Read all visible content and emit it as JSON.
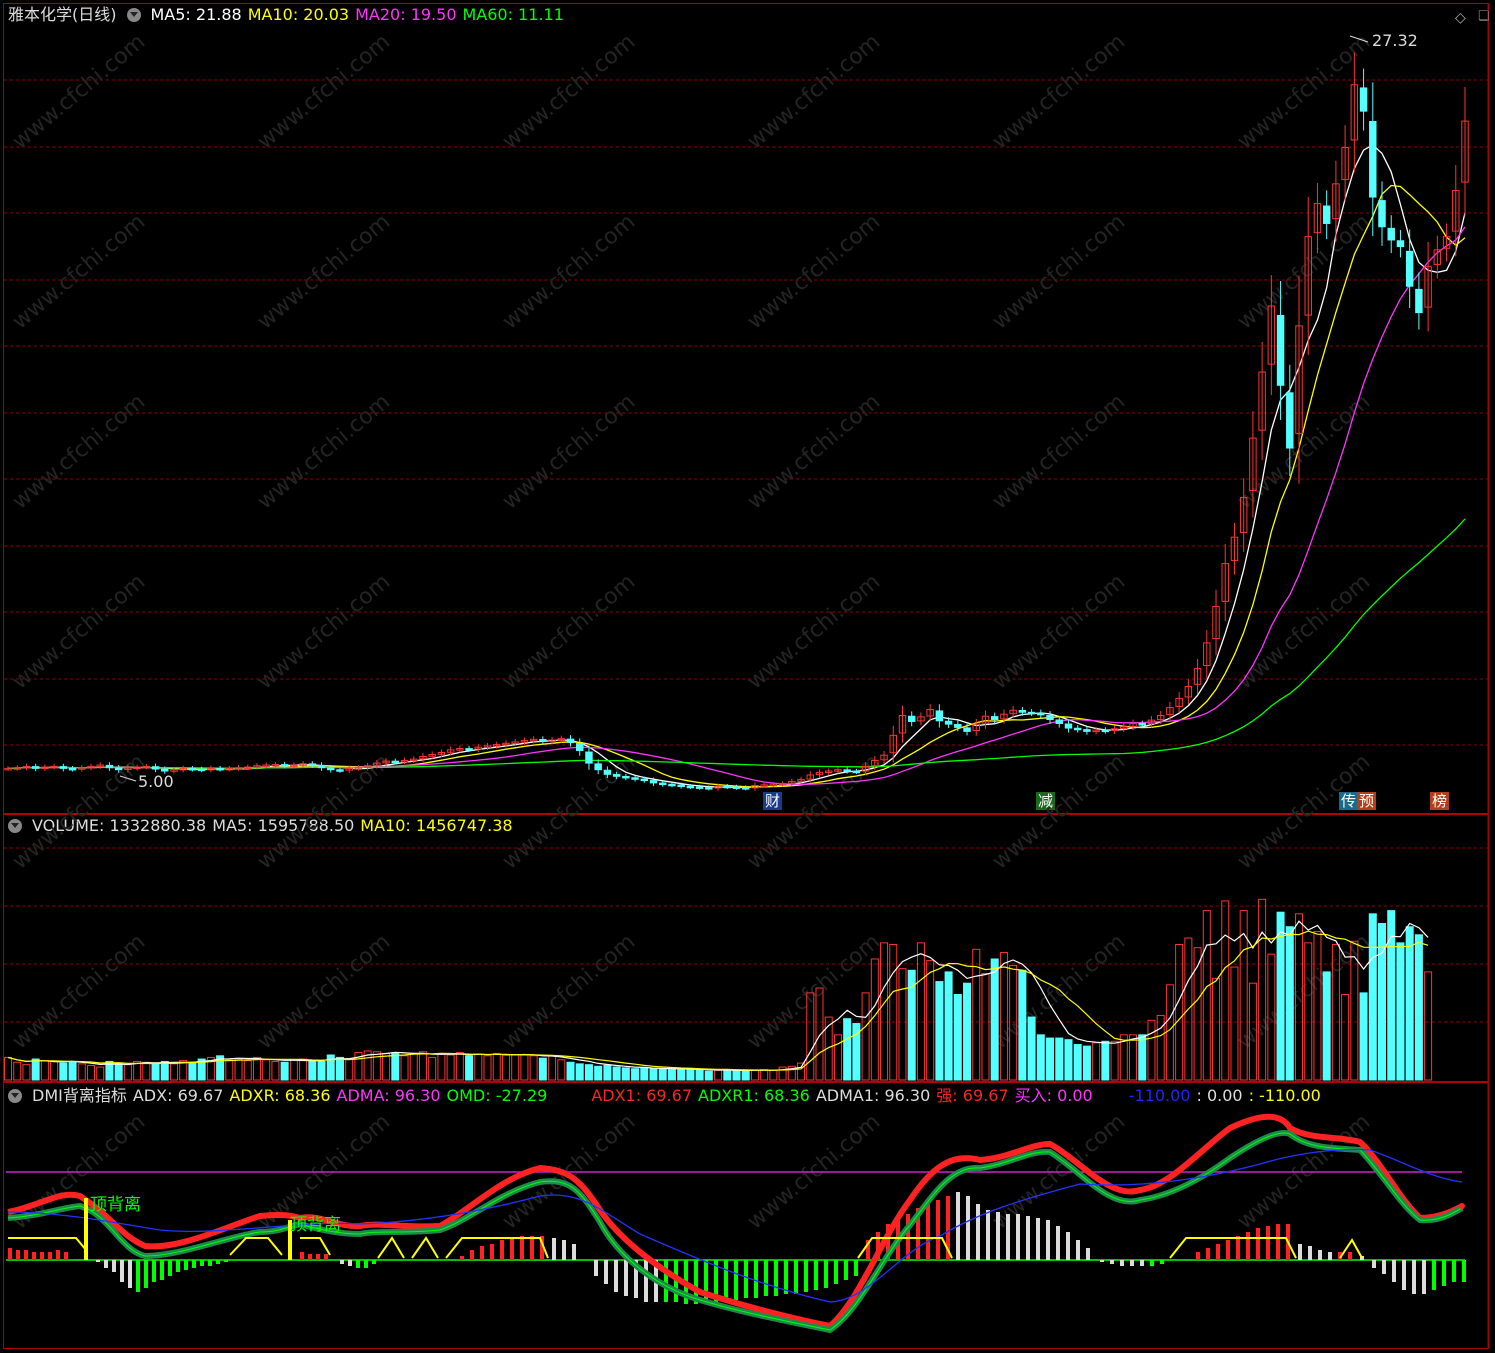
{
  "price_legend": {
    "title": "雅本化学(日线)",
    "ma5": "MA5: 21.88",
    "ma10": "MA10: 20.03",
    "ma20": "MA20: 19.50",
    "ma60": "MA60: 11.11"
  },
  "volume_legend": {
    "volume": "VOLUME: 1332880.38",
    "ma5": "MA5: 1595788.50",
    "ma10": "MA10: 1456747.38"
  },
  "dmi_legend": {
    "title": "DMI背离指标",
    "adx": "ADX: 69.67",
    "adxr": "ADXR: 68.36",
    "adma": "ADMA: 96.30",
    "omd": "OMD: -27.29",
    "adx1": "ADX1: 69.67",
    "adxr1": "ADXR1: 68.36",
    "adma1": "ADMA1: 96.30",
    "qiang": "强: 69.67",
    "mairu": "买入: 0.00",
    "v1": "-110.00",
    "v2": ": 0.00",
    "v3": ": -110.00"
  },
  "annotations": {
    "high_label": "27.32",
    "low_label": "5.00",
    "divergence_1": "顶背离",
    "divergence_2": "顶背离"
  },
  "event_tags": [
    "财",
    "减",
    "传",
    "预",
    "榜"
  ],
  "colors": {
    "up": "#ff3333",
    "down": "#54ffff",
    "ma5": "#ffffff",
    "ma10": "#ffff00",
    "ma20": "#ff33ff",
    "ma60": "#00ff00",
    "grid": "#8b0000"
  },
  "chart_data": [
    {
      "type": "candlestick",
      "title": "雅本化学(日线)",
      "series": [
        {
          "name": "MA5",
          "last": 21.88
        },
        {
          "name": "MA10",
          "last": 20.03
        },
        {
          "name": "MA20",
          "last": 19.5
        },
        {
          "name": "MA60",
          "last": 11.11
        }
      ],
      "ylim": [
        4.4,
        28.2
      ],
      "close": [
        5.6,
        5.62,
        5.66,
        5.6,
        5.64,
        5.66,
        5.6,
        5.58,
        5.62,
        5.66,
        5.7,
        5.62,
        5.56,
        5.62,
        5.64,
        5.66,
        5.58,
        5.52,
        5.56,
        5.6,
        5.58,
        5.56,
        5.6,
        5.58,
        5.6,
        5.62,
        5.64,
        5.68,
        5.7,
        5.72,
        5.68,
        5.7,
        5.74,
        5.7,
        5.62,
        5.56,
        5.54,
        5.6,
        5.62,
        5.68,
        5.76,
        5.82,
        5.8,
        5.84,
        5.88,
        5.96,
        6.02,
        6.08,
        6.16,
        6.2,
        6.18,
        6.24,
        6.28,
        6.32,
        6.36,
        6.4,
        6.44,
        6.48,
        6.42,
        6.46,
        6.5,
        6.38,
        6.14,
        5.76,
        5.56,
        5.42,
        5.36,
        5.32,
        5.28,
        5.24,
        5.16,
        5.12,
        5.1,
        5.06,
        5.04,
        5.02,
        5,
        5.06,
        5.04,
        5.02,
        5,
        5.08,
        5.1,
        5.12,
        5.14,
        5.2,
        5.26,
        5.4,
        5.48,
        5.52,
        5.56,
        5.52,
        5.5,
        5.66,
        5.84,
        6,
        6.6,
        7.2,
        7.02,
        7.16,
        7.38,
        7.04,
        6.94,
        6.84,
        6.72,
        6.94,
        7.18,
        7.08,
        7.24,
        7.36,
        7.3,
        7.28,
        7.22,
        7.08,
        6.96,
        6.82,
        6.78,
        6.72,
        6.76,
        6.74,
        6.8,
        6.86,
        6.96,
        6.94,
        7.06,
        7.2,
        7.44,
        7.72,
        8.08,
        8.62,
        9.4,
        10.5,
        11.8,
        12.6,
        13.8,
        15.6,
        17.6,
        19.6,
        17.2,
        15.3,
        19,
        21.7,
        22.7,
        22.1,
        23.3,
        24.4,
        26.3,
        25.5,
        22.9,
        22,
        21.6,
        21.4,
        20.2,
        19.4,
        20.8,
        21.3,
        21.7,
        23.1,
        25.2
      ],
      "volume_ylim": [
        0,
        3000000
      ],
      "volume": [
        280000,
        220000,
        190000,
        260000,
        240000,
        230000,
        210000,
        220000,
        200000,
        180000,
        160000,
        230000,
        210000,
        190000,
        230000,
        220000,
        210000,
        230000,
        200000,
        240000,
        220000,
        260000,
        280000,
        300000,
        250000,
        260000,
        240000,
        280000,
        250000,
        230000,
        220000,
        250000,
        260000,
        240000,
        230000,
        310000,
        280000,
        260000,
        340000,
        360000,
        350000,
        330000,
        340000,
        300000,
        330000,
        350000,
        280000,
        330000,
        310000,
        340000,
        300000,
        320000,
        300000,
        330000,
        310000,
        310000,
        310000,
        300000,
        270000,
        300000,
        250000,
        220000,
        200000,
        190000,
        170000,
        180000,
        160000,
        150000,
        140000,
        150000,
        140000,
        130000,
        140000,
        130000,
        140000,
        120000,
        110000,
        120000,
        130000,
        120000,
        110000,
        120000,
        130000,
        120000,
        160000,
        170000,
        210000,
        1080000,
        1140000,
        780000,
        560000,
        760000,
        700000,
        1080000,
        1500000,
        1700000,
        1680000,
        1380000,
        1360000,
        1700000,
        1480000,
        1220000,
        1340000,
        1060000,
        1200000,
        1620000,
        1320000,
        1500000,
        1580000,
        1420000,
        1360000,
        780000,
        560000,
        520000,
        520000,
        500000,
        440000,
        420000,
        460000,
        480000,
        480000,
        560000,
        560000,
        560000,
        740000,
        800000,
        1180000,
        1680000,
        1760000,
        1640000,
        2100000,
        1260000,
        2220000,
        1400000,
        2100000,
        1200000,
        2240000,
        1560000,
        2080000,
        1900000,
        2060000,
        1700000,
        1840000,
        1340000,
        1680000,
        1060000,
        1720000,
        1080000,
        2060000,
        1940000,
        2100000,
        1700000,
        1900000,
        1800000,
        1340000
      ]
    },
    {
      "type": "line",
      "title": "DMI背离指标",
      "series": [
        {
          "name": "ADX",
          "last": 69.67
        },
        {
          "name": "ADXR",
          "last": 68.36
        },
        {
          "name": "ADMA",
          "last": 96.3
        },
        {
          "name": "OMD",
          "last": -27.29
        }
      ]
    }
  ]
}
